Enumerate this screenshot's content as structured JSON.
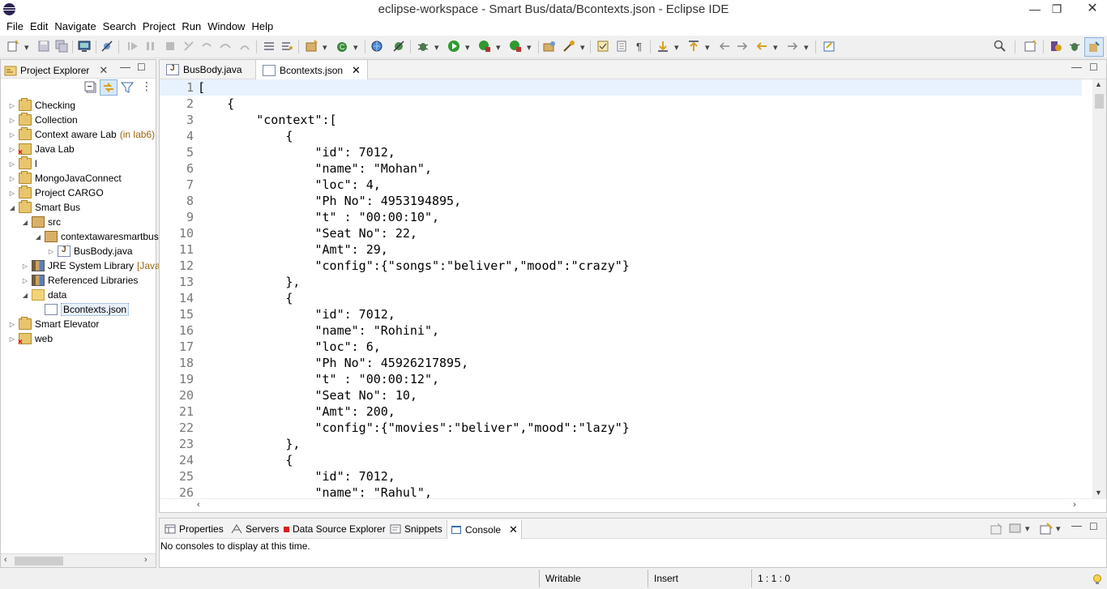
{
  "window": {
    "title": "eclipse-workspace - Smart Bus/data/Bcontexts.json - Eclipse IDE"
  },
  "menu": [
    "File",
    "Edit",
    "Navigate",
    "Search",
    "Project",
    "Run",
    "Window",
    "Help"
  ],
  "project_explorer": {
    "tab_label": "Project Explorer",
    "tree": [
      {
        "label": "Checking",
        "icon": "project-icon",
        "expanded": false
      },
      {
        "label": "Collection",
        "icon": "project-icon",
        "expanded": false
      },
      {
        "label": "Context aware Lab",
        "decoration": "(in lab6)",
        "icon": "project-icon",
        "expanded": false
      },
      {
        "label": "Java Lab",
        "icon": "project-error-icon",
        "expanded": false
      },
      {
        "label": "l",
        "icon": "project-icon",
        "expanded": false
      },
      {
        "label": "MongoJavaConnect",
        "icon": "project-icon",
        "expanded": false
      },
      {
        "label": "Project CARGO",
        "icon": "project-icon",
        "expanded": false
      },
      {
        "label": "Smart Bus",
        "icon": "project-icon",
        "expanded": true
      },
      {
        "label": "src",
        "icon": "source-folder-icon",
        "expanded": true
      },
      {
        "label": "contextawaresmartbus",
        "icon": "package-icon",
        "expanded": true
      },
      {
        "label": "BusBody.java",
        "icon": "java-file-icon",
        "expanded": false
      },
      {
        "label": "JRE System Library",
        "decoration": "[JavaS",
        "icon": "library-icon",
        "expanded": false
      },
      {
        "label": "Referenced Libraries",
        "icon": "library-icon",
        "expanded": false
      },
      {
        "label": "data",
        "icon": "folder-icon",
        "expanded": true
      },
      {
        "label": "Bcontexts.json",
        "icon": "file-icon",
        "expanded": false
      },
      {
        "label": "Smart Elevator",
        "icon": "project-icon",
        "expanded": false
      },
      {
        "label": "web",
        "icon": "project-error-icon",
        "expanded": false
      }
    ]
  },
  "editor": {
    "tabs": [
      {
        "label": "BusBody.java",
        "icon": "java-file-icon",
        "active": false
      },
      {
        "label": "Bcontexts.json",
        "icon": "file-icon",
        "active": true
      }
    ],
    "lines": [
      "[",
      "    {",
      "        \"context\":[",
      "            {",
      "                \"id\": 7012,",
      "                \"name\": \"Mohan\",",
      "                \"loc\": 4,",
      "                \"Ph No\": 4953194895,",
      "                \"t\" : \"00:00:10\",",
      "                \"Seat No\": 22,",
      "                \"Amt\": 29,",
      "                \"config\":{\"songs\":\"beliver\",\"mood\":\"crazy\"}",
      "            },",
      "            {",
      "                \"id\": 7012,",
      "                \"name\": \"Rohini\",",
      "                \"loc\": 6,",
      "                \"Ph No\": 45926217895,",
      "                \"t\" : \"00:00:12\",",
      "                \"Seat No\": 10,",
      "                \"Amt\": 200,",
      "                \"config\":{\"movies\":\"beliver\",\"mood\":\"lazy\"}",
      "            },",
      "            {",
      "                \"id\": 7012,",
      "                \"name\": \"Rahul\","
    ]
  },
  "console": {
    "tabs": [
      "Properties",
      "Servers",
      "Data Source Explorer",
      "Snippets",
      "Console"
    ],
    "active_tab": "Console",
    "message": "No consoles to display at this time."
  },
  "status": {
    "writable": "Writable",
    "insert": "Insert",
    "position": "1 : 1 : 0"
  },
  "colors": {
    "accent": "#3f85d8",
    "line_numbers": "#787878",
    "current_line": "#e8f2fe"
  }
}
